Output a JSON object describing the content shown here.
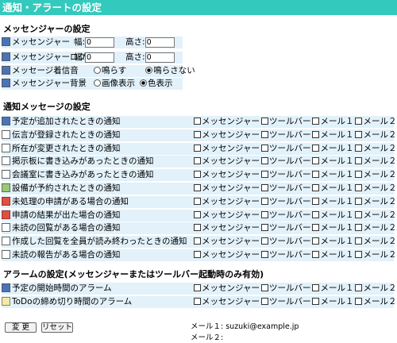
{
  "window": {
    "title": "通知・アラートの設定"
  },
  "messenger_section": {
    "title": "メッセンジャーの設定",
    "size_rows": [
      {
        "label": "メッセンジャー",
        "width_label": "幅:",
        "width_value": "0",
        "height_label": "高さ:",
        "height_value": "0"
      },
      {
        "label": "メッセンジャーログ",
        "width_label": "幅:",
        "width_value": "0",
        "height_label": "高さ:",
        "height_value": "0"
      }
    ],
    "sound": {
      "label": "メッセージ着信音",
      "options": [
        "鳴らす",
        "鳴らさない"
      ],
      "selected": "鳴らさない"
    },
    "background": {
      "label": "メッセンジャー背景",
      "options": [
        "画像表示",
        "色表示"
      ],
      "selected": "色表示"
    }
  },
  "notify_section": {
    "title": "通知メッセージの設定",
    "option_labels": [
      "メッセンジャー",
      "ツールバー",
      "メール１",
      "メール２"
    ],
    "rows": [
      {
        "label": "予定が追加されたときの通知",
        "icon": "schedule-icon"
      },
      {
        "label": "伝言が登録されたときの通知",
        "icon": "message-icon"
      },
      {
        "label": "所在が変更されたときの通知",
        "icon": "location-icon"
      },
      {
        "label": "掲示板に書き込みがあったときの通知",
        "icon": "bulletin-icon"
      },
      {
        "label": "会議室に書き込みがあったときの通知",
        "icon": "meeting-room-icon"
      },
      {
        "label": "設備が予約されたときの通知",
        "icon": "equipment-icon"
      },
      {
        "label": "未処理の申請がある場合の通知",
        "icon": "pending-request-icon"
      },
      {
        "label": "申請の結果が出た場合の通知",
        "icon": "request-result-icon"
      },
      {
        "label": "未読の回覧がある場合の通知",
        "icon": "circular-icon"
      },
      {
        "label": "作成した回覧を全員が読み終わったときの通知",
        "icon": "circular-read-icon"
      },
      {
        "label": "未読の報告がある場合の通知",
        "icon": "report-icon"
      }
    ]
  },
  "alarm_section": {
    "title": "アラームの設定(メッセンジャーまたはツールバー起動時のみ有効)",
    "rows": [
      {
        "label": "予定の開始時間のアラーム",
        "icon": "schedule-alarm-icon"
      },
      {
        "label": "ToDoの締め切り時間のアラーム",
        "icon": "todo-alarm-icon"
      }
    ]
  },
  "buttons": {
    "save": "変 更",
    "reset": "リセット"
  },
  "mail_info": {
    "mail1": "メール１: suzuki@example.jp",
    "mail2": "メール２:"
  },
  "colors": {
    "titlebar": "#33c9bd",
    "row_shade": "#e2f1fa"
  }
}
